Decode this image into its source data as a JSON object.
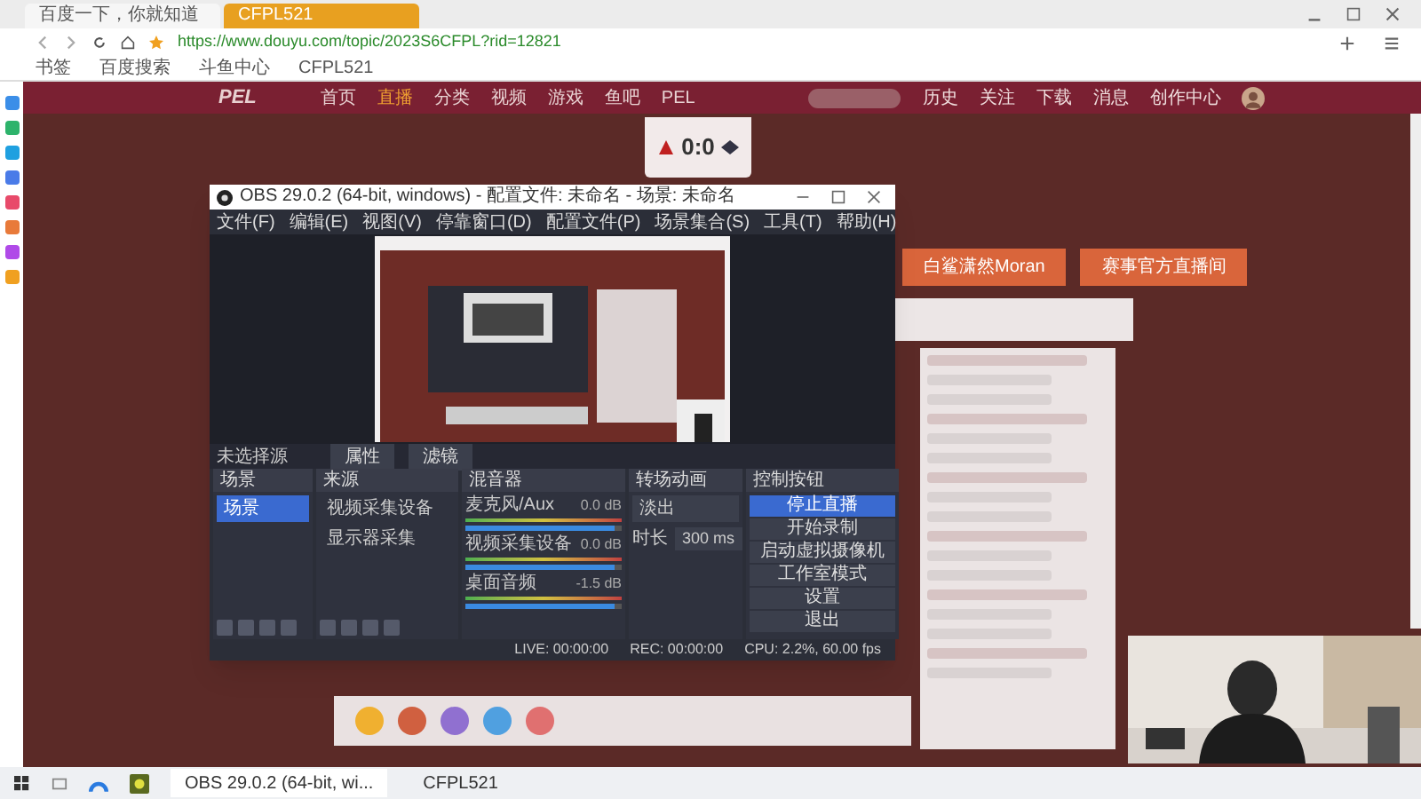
{
  "browser": {
    "tabs": [
      {
        "label": "百度一下，你就知道",
        "selected": false
      },
      {
        "label": "CFPL521",
        "selected": true
      }
    ],
    "url": "https://www.douyu.com/topic/2023S6CFPL?rid=12821",
    "bookmarks": [
      "书签",
      "百度搜索",
      "斗鱼中心",
      "CFPL521"
    ]
  },
  "page": {
    "logo": "PEL",
    "nav": [
      {
        "label": "首页",
        "selected": false
      },
      {
        "label": "直播",
        "selected": true
      },
      {
        "label": "分类",
        "selected": false
      },
      {
        "label": "视频",
        "selected": false
      },
      {
        "label": "游戏",
        "selected": false
      },
      {
        "label": "鱼吧",
        "selected": false
      },
      {
        "label": "PEL",
        "selected": false
      }
    ],
    "header_icons": [
      "历史",
      "关注",
      "下载",
      "消息",
      "创作中心"
    ],
    "score": "0:0",
    "promo_buttons": [
      "白鲨潇然Moran",
      "赛事官方直播间"
    ]
  },
  "obs": {
    "title": "OBS 29.0.2 (64-bit, windows) - 配置文件: 未命名 - 场景: 未命名",
    "menu": [
      "文件(F)",
      "编辑(E)",
      "视图(V)",
      "停靠窗口(D)",
      "配置文件(P)",
      "场景集合(S)",
      "工具(T)",
      "帮助(H)"
    ],
    "no_source": "未选择源",
    "source_buttons": [
      "属性",
      "滤镜"
    ],
    "docks": [
      "场景",
      "来源",
      "混音器",
      "转场动画",
      "控制按钮"
    ],
    "scenes": [
      {
        "label": "场景",
        "selected": true
      }
    ],
    "sources": [
      {
        "label": "视频采集设备"
      },
      {
        "label": "显示器采集"
      }
    ],
    "mixer": [
      {
        "name": "麦克风/Aux",
        "reading": "0.0 dB",
        "level": 0.95
      },
      {
        "name": "视频采集设备",
        "reading": "0.0 dB",
        "level": 0.95
      },
      {
        "name": "桌面音频",
        "reading": "-1.5 dB",
        "level": 0.95
      }
    ],
    "transition": {
      "type": "淡出",
      "duration_label": "时长",
      "duration": "300 ms"
    },
    "controls": [
      {
        "label": "停止直播",
        "selected": true
      },
      {
        "label": "开始录制",
        "selected": false
      },
      {
        "label": "启动虚拟摄像机",
        "selected": false
      },
      {
        "label": "工作室模式",
        "selected": false
      },
      {
        "label": "设置",
        "selected": false
      },
      {
        "label": "退出",
        "selected": false
      }
    ],
    "status": {
      "live": "LIVE: 00:00:00",
      "rec": "REC: 00:00:00",
      "cpu": "CPU: 2.2%, 60.00 fps"
    }
  },
  "taskbar": [
    {
      "label": "OBS 29.0.2 (64-bit, wi...",
      "selected": true
    },
    {
      "label": "CFPL521",
      "selected": false
    }
  ]
}
